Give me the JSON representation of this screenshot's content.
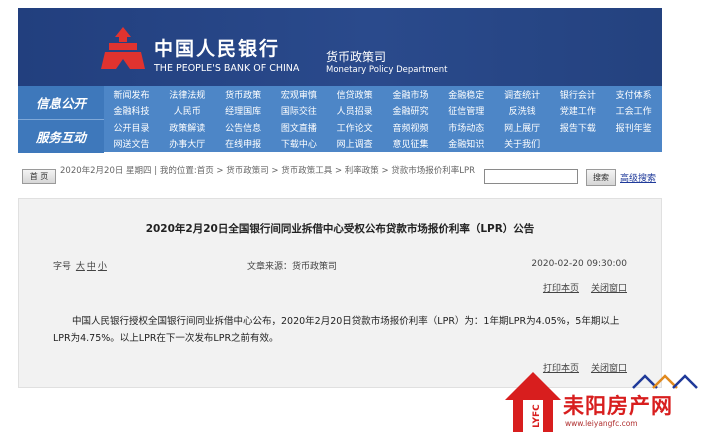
{
  "header": {
    "bank_cn": "中国人民银行",
    "bank_en": "THE PEOPLE'S BANK OF CHINA",
    "dept_cn": "货币政策司",
    "dept_en": "Monetary Policy Department",
    "bg_color": "#223f7e"
  },
  "nav": {
    "section1": "信息公开",
    "section2": "服务互动",
    "rows": [
      [
        "新闻发布",
        "法律法规",
        "货币政策",
        "宏观审慎",
        "信贷政策",
        "金融市场",
        "金融稳定",
        "调查统计",
        "银行会计",
        "支付体系"
      ],
      [
        "金融科技",
        "人民币",
        "经理国库",
        "国际交往",
        "人员招录",
        "金融研究",
        "征信管理",
        "反洗钱",
        "党建工作",
        "工会工作"
      ],
      [
        "公开目录",
        "政策解读",
        "公告信息",
        "图文直播",
        "工作论文",
        "音频视频",
        "市场动态",
        "网上展厅",
        "报告下载",
        "报刊年鉴"
      ],
      [
        "网送文告",
        "办事大厅",
        "在线申报",
        "下载中心",
        "网上调查",
        "意见征集",
        "金融知识",
        "关于我们"
      ]
    ]
  },
  "breadcrumb": {
    "home_label": "首 页",
    "text": "2020年2月20日 星期四 | 我的位置:首页 > 货币政策司 > 货币政策工具 > 利率政策 > 贷款市场报价利率LPR",
    "search_button": "搜索",
    "advanced_search": "高级搜索"
  },
  "article": {
    "title": "2020年2月20日全国银行间同业拆借中心受权公布贷款市场报价利率（LPR）公告",
    "font_size_label": "字号",
    "font_sizes": [
      "大",
      "中",
      "小"
    ],
    "source": "文章来源：货币政策司",
    "date": "2020-02-20 09:30:00",
    "print_label": "打印本页",
    "close_label": "关闭窗口",
    "body": "中国人民银行授权全国银行间同业拆借中心公布，2020年2月20日贷款市场报价利率（LPR）为：1年期LPR为4.05%，5年期以上LPR为4.75%。以上LPR在下一次发布LPR之前有效。"
  },
  "watermark": {
    "side_text": "LYFC",
    "cn": "耒阳房产网",
    "url": "www.leiyangfc.com",
    "color": "#d81e1e"
  }
}
